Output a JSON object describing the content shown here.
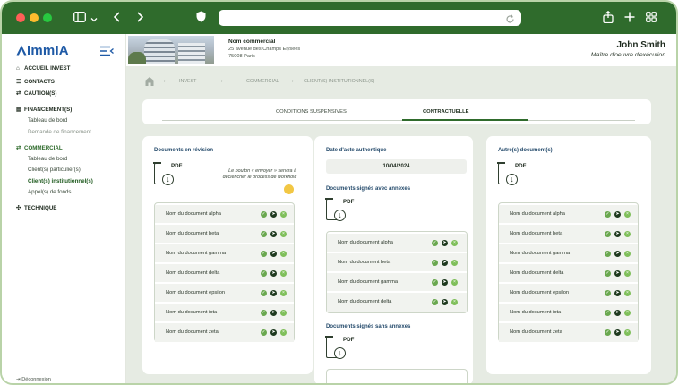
{
  "browser": {
    "traffic_lights": [
      "#ff5f57",
      "#febc2e",
      "#28c840"
    ],
    "icons": [
      "sidebar-toggle-icon",
      "chevron-down-icon",
      "back-icon",
      "forward-icon",
      "shield-icon",
      "reload-icon",
      "share-icon",
      "new-tab-icon",
      "tabs-grid-icon"
    ]
  },
  "sidebar": {
    "logo": "ImmIA",
    "items": [
      {
        "label": "ACCUEIL INVEST",
        "icon": "home-icon"
      },
      {
        "label": "CONTACTS",
        "icon": "contacts-icon"
      },
      {
        "label": "CAUTION(S)",
        "icon": "handshake-icon"
      },
      {
        "label": "FINANCEMENT(S)",
        "icon": "document-icon"
      },
      {
        "label": "Tableau de bord"
      },
      {
        "label": "Demande de financement"
      },
      {
        "label": "COMMERCIAL",
        "icon": "handshake-icon"
      },
      {
        "label": "Tableau de bord"
      },
      {
        "label": "Client(s) particulier(s)"
      },
      {
        "label": "Client(s) institutionnel(s)"
      },
      {
        "label": "Appel(s) de fonds"
      },
      {
        "label": "TECHNIQUE",
        "icon": "tools-icon"
      }
    ],
    "logout": "Déconnexion"
  },
  "header": {
    "title": "Nom commercial",
    "address_line1": "25 avenue des Champs Elysées",
    "address_line2": "75008 Paris",
    "user_name": "John Smith",
    "user_role": "Maître d'oeuvre d'exécution"
  },
  "breadcrumb": [
    "INVEST",
    "COMMERCIAL",
    "CLIENT(S) INSTITUTIONNEL(S)"
  ],
  "tabs": [
    {
      "label": "CONDITIONS SUSPENSIVES",
      "active": false
    },
    {
      "label": "CONTRACTUELLE",
      "active": true
    }
  ],
  "cards": {
    "revision": {
      "title": "Documents en révision",
      "pdf_label": "PDF",
      "tooltip_line1": "Le bouton « envoyer » servira à",
      "tooltip_line2": "déclencher le process de workflow",
      "documents": [
        "Nom du document alpha",
        "Nom du document beta",
        "Nom du document gamma",
        "Nom du document delta",
        "Nom du document epsilon",
        "Nom du document iota",
        "Nom du document zeta"
      ]
    },
    "middle": {
      "date_title": "Date d'acte authentique",
      "date_value": "10/04/2024",
      "with_annex_title": "Documents signés avec annexes",
      "pdf_label": "PDF",
      "with_annex_docs": [
        "Nom du document alpha",
        "Nom du document beta",
        "Nom du document gamma",
        "Nom du document delta"
      ],
      "without_annex_title": "Documents signés sans annexes"
    },
    "other": {
      "title": "Autre(s) document(s)",
      "pdf_label": "PDF",
      "documents": [
        "Nom du document alpha",
        "Nom du document beta",
        "Nom du document gamma",
        "Nom du document delta",
        "Nom du document epsilon",
        "Nom du document iota",
        "Nom du document zeta"
      ]
    }
  },
  "row_actions": [
    "check-icon",
    "send-icon",
    "close-icon"
  ],
  "colors": {
    "accent": "#2f6b2c",
    "title_blue": "#244a6b",
    "logo_blue": "#1f5aa6"
  }
}
